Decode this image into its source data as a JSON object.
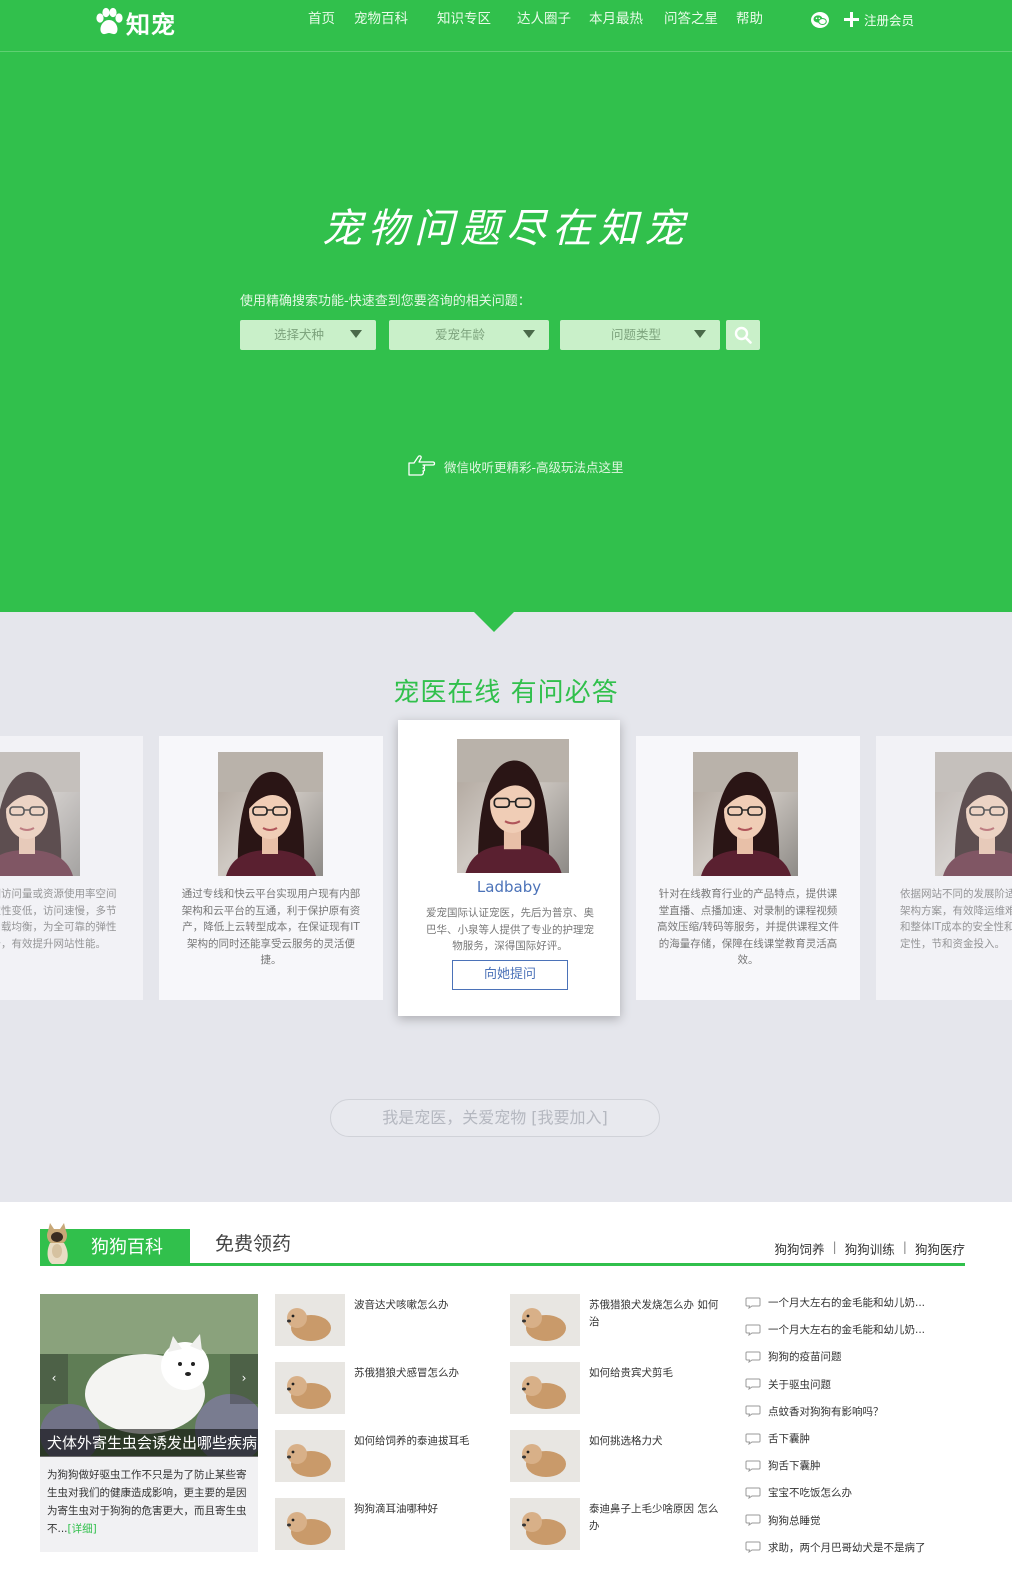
{
  "header": {
    "logo_text": "知宠",
    "nav": [
      "首页",
      "宠物百科",
      "知识专区",
      "达人圈子",
      "本月最热",
      "问答之星",
      "帮助"
    ],
    "register": "注册会员"
  },
  "hero": {
    "slogan": "宠物问题尽在知宠",
    "search_hint": "使用精确搜索功能-快速查到您要咨询的相关问题：",
    "filters": [
      "选择犬种",
      "爱宠年龄",
      "问题类型"
    ],
    "wechat_link": "微信收听更精彩-高级玩法点这里"
  },
  "vets": {
    "title": "宠医在线 有问必答",
    "cards": [
      {
        "desc": "站因访问量或资源使用率空间稳定性变低，访问速慢，多节点负载均衡，为全可靠的弹性服务，有效提升网站性能。"
      },
      {
        "desc": "通过专线和快云平台实现用户现有内部架构和云平台的互通，利于保护原有资产，降低上云转型成本，在保证现有IT架构的同时还能享受云服务的灵活便捷。"
      },
      {
        "name": "Ladbaby",
        "desc": "爱宠国际认证宠医，先后为普京、奥巴华、小泉等人提供了专业的护理宠物服务，深得国际好评。",
        "button": "向她提问"
      },
      {
        "desc": "针对在线教育行业的产品特点，提供课堂直播、点播加速、对录制的课程视频高效压缩/转码等服务，并提供课程文件的海量存储，保障在线课堂教育灵活高效。"
      },
      {
        "desc": "依据网站不同的发展阶适的架构方案，有效降运维难度和整体IT成本的安全性和稳定性，节和资金投入。"
      }
    ],
    "join": "我是宠医，关爱宠物 [我要加入]"
  },
  "dog": {
    "tab_active": "狗狗百科",
    "tab_2": "免费领药",
    "sub_links": [
      "狗狗饲养",
      "狗狗训练",
      "狗狗医疗"
    ],
    "feature": {
      "caption": "犬体外寄生虫会诱发出哪些疾病",
      "text": "为狗狗做好驱虫工作不只是为了防止某些寄生虫对我们的健康造成影响，更主要的是因为寄生虫对于狗狗的危害更大，而且寄生虫不...",
      "more": "[详细]"
    },
    "column1": [
      "波音达犬咳嗽怎么办",
      "苏俄猎狼犬感冒怎么办",
      "如何给饲养的泰迪拔耳毛",
      "狗狗滴耳油哪种好"
    ],
    "column2": [
      "苏俄猎狼犬发烧怎么办 如何治",
      "如何给贵宾犬剪毛",
      "如何挑选格力犬",
      "泰迪鼻子上毛少啥原因 怎么办"
    ],
    "qa": [
      "一个月大左右的金毛能和幼儿奶...",
      "一个月大左右的金毛能和幼儿奶...",
      "狗狗的疫苗问题",
      "关于驱虫问题",
      "点蚊香对狗狗有影响吗？",
      "舌下囊肿",
      "狗舌下囊肿",
      "宝宝不吃饭怎么办",
      "狗狗总睡觉",
      "求助，两个月巴哥幼犬是不是病了"
    ]
  }
}
